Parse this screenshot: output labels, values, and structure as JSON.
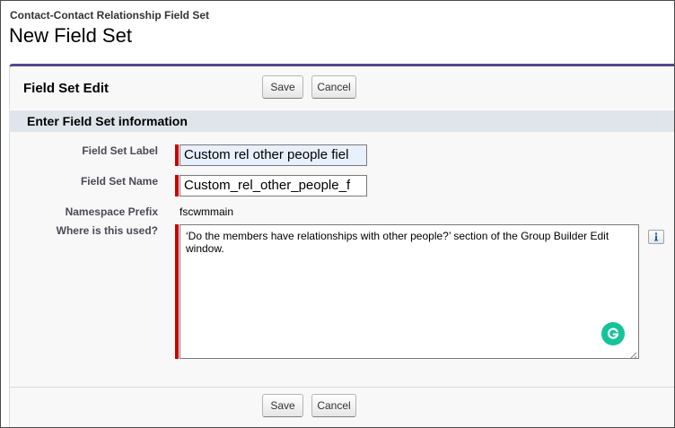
{
  "header": {
    "subtitle": "Contact-Contact Relationship Field Set",
    "title": "New Field Set"
  },
  "panel": {
    "title": "Field Set Edit",
    "save_label": "Save",
    "cancel_label": "Cancel",
    "accent_color": "#56458c"
  },
  "section": {
    "title": "Enter Field Set information"
  },
  "fields": {
    "label": {
      "label": "Field Set Label",
      "value": "Custom rel other people fiel"
    },
    "name": {
      "label": "Field Set Name",
      "value": "Custom_rel_other_people_f"
    },
    "namespace": {
      "label": "Namespace Prefix",
      "value": "fscwmmain"
    },
    "usage": {
      "label": "Where is this used?",
      "value": "‘Do the members have relationships with other people?’ section of the Group Builder Edit window."
    }
  },
  "icons": {
    "info": "info-icon",
    "grammarly": "grammarly-icon",
    "resize": "resize-grip-icon"
  },
  "colors": {
    "required": "#cc0000",
    "section_bg": "#dfe5ea",
    "grammarly": "#15c39a"
  }
}
